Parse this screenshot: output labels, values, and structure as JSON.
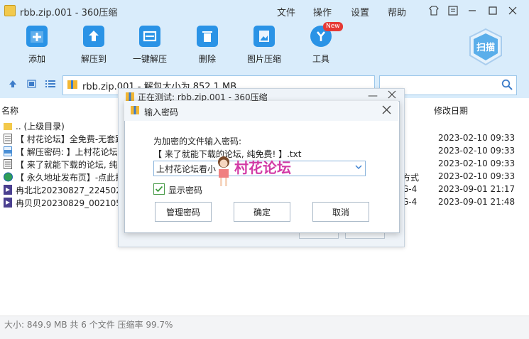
{
  "window": {
    "title": "rbb.zip.001 - 360压缩"
  },
  "menu": [
    "文件",
    "操作",
    "设置",
    "帮助"
  ],
  "toolbar": {
    "items": [
      "添加",
      "解压到",
      "一键解压",
      "删除",
      "图片压缩",
      "工具"
    ],
    "new_badge": "New",
    "scan_label": "扫描"
  },
  "address": {
    "text": "rbb.zip.001 - 解包大小为 852.1 MB"
  },
  "columns": {
    "name": "名称",
    "modified": "修改日期"
  },
  "files": [
    {
      "name": ".. (上级目录)",
      "extra": "",
      "date": ""
    },
    {
      "name": "【 村花论坛】全免费-无套路",
      "extra": "",
      "date": "2023-02-10 09:33"
    },
    {
      "name": "【 解压密码: 】上村花论坛",
      "extra": "",
      "date": "2023-02-10 09:33"
    },
    {
      "name": "【 来了就能下载的论坛, 纯",
      "extra": "",
      "date": "2023-02-10 09:33"
    },
    {
      "name": "【 永久地址发布页】-点此打",
      "extra": "方式",
      "date": "2023-02-10 09:33"
    },
    {
      "name": "冉北北20230827_224502.m",
      "extra": "G-4",
      "date": "2023-09-01 21:17"
    },
    {
      "name": "冉贝贝20230829_002105a",
      "extra": "G-4",
      "date": "2023-09-01 21:48"
    }
  ],
  "status": "大小: 849.9 MB 共 6 个文件 压缩率 99.7%",
  "test_dialog": {
    "title": "正在测试: rbb.zip.001 - 360压缩"
  },
  "password_dialog": {
    "title": "输入密码",
    "prompt": "为加密的文件输入密码:",
    "filename": "【 来了就能下载的论坛, 纯免费! 】.txt",
    "password_value": "上村花论坛看小",
    "show_password_label": "显示密码",
    "show_password_checked": true,
    "buttons": {
      "manage": "管理密码",
      "ok": "确定",
      "cancel": "取消"
    }
  },
  "watermark": {
    "text": "村花论坛"
  }
}
